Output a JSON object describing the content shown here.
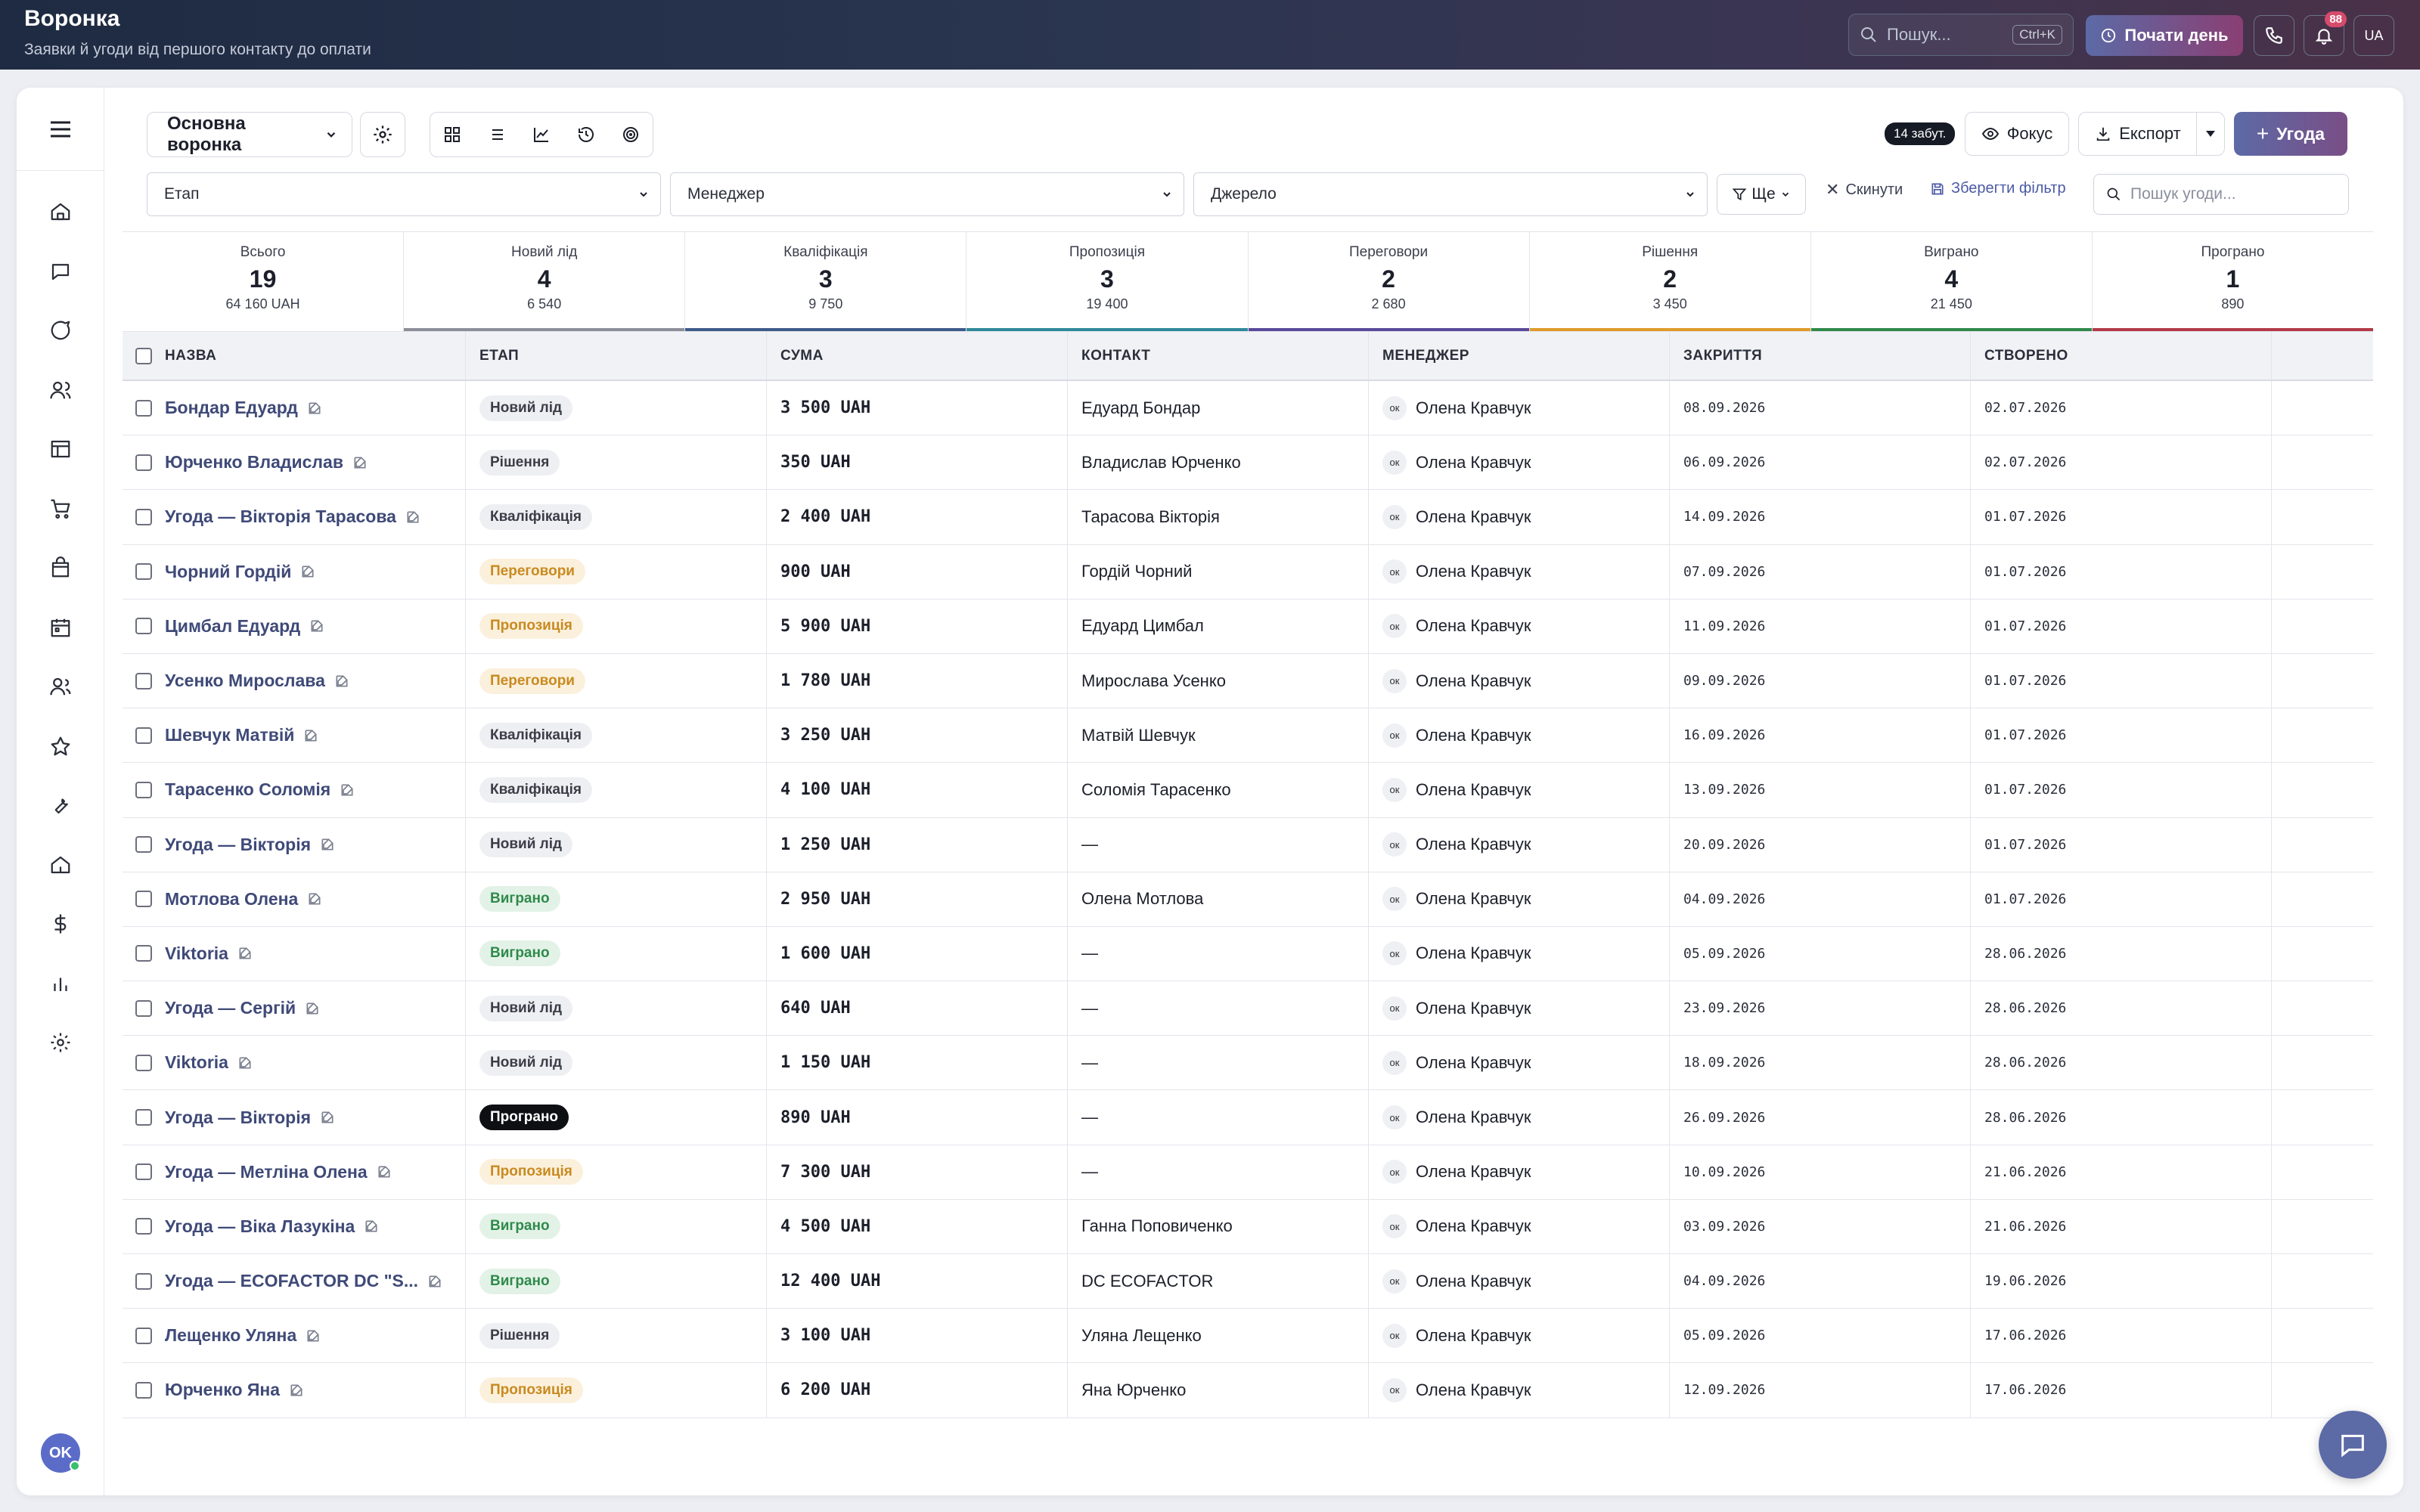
{
  "header": {
    "title": "Воронка",
    "subtitle": "Заявки й угоди від першого контакту до оплати",
    "search_placeholder": "Пошук...",
    "search_shortcut": "Ctrl+K",
    "start_day_label": "Почати день",
    "notifications_count": "88",
    "lang": "UA"
  },
  "sidebar": {
    "icons": [
      "home-icon",
      "chat-icon",
      "message-icon",
      "users-icon",
      "layout-icon",
      "cart-icon",
      "bag-icon",
      "calendar-icon",
      "team-icon",
      "star-icon",
      "wrench-icon",
      "building-icon",
      "dollar-icon",
      "chart-icon",
      "settings-icon"
    ],
    "user_initials": "OK"
  },
  "toolbar": {
    "funnel_label": "Основна воронка",
    "forgotten_badge": "14 забут.",
    "focus_label": "Фокус",
    "export_label": "Експорт",
    "add_deal_label": "Угода"
  },
  "filters": {
    "stage": "Етап",
    "manager": "Менеджер",
    "source": "Джерело",
    "more": "Ще",
    "reset": "Скинути",
    "save": "Зберегти фільтр",
    "search_placeholder": "Пошук угоди..."
  },
  "stats": [
    {
      "label": "Всього",
      "count": "19",
      "sum": "64 160 UAH",
      "color": "#ffffff"
    },
    {
      "label": "Новий лід",
      "count": "4",
      "sum": "6 540",
      "color": "#8c8f99"
    },
    {
      "label": "Кваліфікація",
      "count": "3",
      "sum": "9 750",
      "color": "#3d5a8a"
    },
    {
      "label": "Пропозиція",
      "count": "3",
      "sum": "19 400",
      "color": "#2e8a9a"
    },
    {
      "label": "Переговори",
      "count": "2",
      "sum": "2 680",
      "color": "#5a4a9a"
    },
    {
      "label": "Рішення",
      "count": "2",
      "sum": "3 450",
      "color": "#e09a2a"
    },
    {
      "label": "Виграно",
      "count": "4",
      "sum": "21 450",
      "color": "#2f8a4b"
    },
    {
      "label": "Програно",
      "count": "1",
      "sum": "890",
      "color": "#b23a4a"
    }
  ],
  "table": {
    "columns": [
      "НАЗВА",
      "ЕТАП",
      "СУМА",
      "КОНТАКТ",
      "МЕНЕДЖЕР",
      "ЗАКРИТТЯ",
      "СТВОРЕНО"
    ],
    "rows": [
      {
        "name": "Бондар Едуард",
        "stage": "Новий лід",
        "stage_class": "p-new",
        "sum": "3 500 UAH",
        "contact": "Едуард Бондар",
        "mgr_initials": "ок",
        "manager": "Олена Кравчук",
        "close": "08.09.2026",
        "created": "02.07.2026"
      },
      {
        "name": "Юрченко Владислав",
        "stage": "Рішення",
        "stage_class": "p-dec",
        "sum": "350 UAH",
        "contact": "Владислав Юрченко",
        "mgr_initials": "ок",
        "manager": "Олена Кравчук",
        "close": "06.09.2026",
        "created": "02.07.2026"
      },
      {
        "name": "Угода — Вікторія Тарасова",
        "stage": "Кваліфікація",
        "stage_class": "p-qual",
        "sum": "2 400 UAH",
        "contact": "Тарасова Вікторія",
        "mgr_initials": "ок",
        "manager": "Олена Кравчук",
        "close": "14.09.2026",
        "created": "01.07.2026"
      },
      {
        "name": "Чорний Гордій",
        "stage": "Переговори",
        "stage_class": "p-neg",
        "sum": "900 UAH",
        "contact": "Гордій Чорний",
        "mgr_initials": "ок",
        "manager": "Олена Кравчук",
        "close": "07.09.2026",
        "created": "01.07.2026"
      },
      {
        "name": "Цимбал Едуард",
        "stage": "Пропозиція",
        "stage_class": "p-prop",
        "sum": "5 900 UAH",
        "contact": "Едуард Цимбал",
        "mgr_initials": "ок",
        "manager": "Олена Кравчук",
        "close": "11.09.2026",
        "created": "01.07.2026"
      },
      {
        "name": "Усенко Мирослава",
        "stage": "Переговори",
        "stage_class": "p-neg",
        "sum": "1 780 UAH",
        "contact": "Мирослава Усенко",
        "mgr_initials": "ок",
        "manager": "Олена Кравчук",
        "close": "09.09.2026",
        "created": "01.07.2026"
      },
      {
        "name": "Шевчук Матвій",
        "stage": "Кваліфікація",
        "stage_class": "p-qual",
        "sum": "3 250 UAH",
        "contact": "Матвій Шевчук",
        "mgr_initials": "ок",
        "manager": "Олена Кравчук",
        "close": "16.09.2026",
        "created": "01.07.2026"
      },
      {
        "name": "Тарасенко Соломія",
        "stage": "Кваліфікація",
        "stage_class": "p-qual",
        "sum": "4 100 UAH",
        "contact": "Соломія Тарасенко",
        "mgr_initials": "ок",
        "manager": "Олена Кравчук",
        "close": "13.09.2026",
        "created": "01.07.2026"
      },
      {
        "name": "Угода — Вікторія",
        "stage": "Новий лід",
        "stage_class": "p-new",
        "sum": "1 250 UAH",
        "contact": "—",
        "mgr_initials": "ок",
        "manager": "Олена Кравчук",
        "close": "20.09.2026",
        "created": "01.07.2026"
      },
      {
        "name": "Мотлова Олена",
        "stage": "Виграно",
        "stage_class": "p-won",
        "sum": "2 950 UAH",
        "contact": "Олена Мотлова",
        "mgr_initials": "ок",
        "manager": "Олена Кравчук",
        "close": "04.09.2026",
        "created": "01.07.2026"
      },
      {
        "name": "Viktoria",
        "stage": "Виграно",
        "stage_class": "p-won",
        "sum": "1 600 UAH",
        "contact": "—",
        "mgr_initials": "ок",
        "manager": "Олена Кравчук",
        "close": "05.09.2026",
        "created": "28.06.2026"
      },
      {
        "name": "Угода — Сергій",
        "stage": "Новий лід",
        "stage_class": "p-new",
        "sum": "640 UAH",
        "contact": "—",
        "mgr_initials": "ок",
        "manager": "Олена Кравчук",
        "close": "23.09.2026",
        "created": "28.06.2026"
      },
      {
        "name": "Viktoria",
        "stage": "Новий лід",
        "stage_class": "p-new",
        "sum": "1 150 UAH",
        "contact": "—",
        "mgr_initials": "ок",
        "manager": "Олена Кравчук",
        "close": "18.09.2026",
        "created": "28.06.2026"
      },
      {
        "name": "Угода — Вікторія",
        "stage": "Програно",
        "stage_class": "p-lost",
        "sum": "890 UAH",
        "contact": "—",
        "mgr_initials": "ок",
        "manager": "Олена Кравчук",
        "close": "26.09.2026",
        "created": "28.06.2026"
      },
      {
        "name": "Угода — Метліна Олена",
        "stage": "Пропозиція",
        "stage_class": "p-prop",
        "sum": "7 300 UAH",
        "contact": "—",
        "mgr_initials": "ок",
        "manager": "Олена Кравчук",
        "close": "10.09.2026",
        "created": "21.06.2026"
      },
      {
        "name": "Угода — Віка Лазукіна",
        "stage": "Виграно",
        "stage_class": "p-won",
        "sum": "4 500 UAH",
        "contact": "Ганна Поповиченко",
        "mgr_initials": "ок",
        "manager": "Олена Кравчук",
        "close": "03.09.2026",
        "created": "21.06.2026"
      },
      {
        "name": "Угода — ECOFACTOR DC \"S...",
        "stage": "Виграно",
        "stage_class": "p-won",
        "sum": "12 400 UAH",
        "contact": "DC ECOFACTOR",
        "mgr_initials": "ок",
        "manager": "Олена Кравчук",
        "close": "04.09.2026",
        "created": "19.06.2026"
      },
      {
        "name": "Лещенко Уляна",
        "stage": "Рішення",
        "stage_class": "p-dec",
        "sum": "3 100 UAH",
        "contact": "Уляна Лещенко",
        "mgr_initials": "ок",
        "manager": "Олена Кравчук",
        "close": "05.09.2026",
        "created": "17.06.2026"
      },
      {
        "name": "Юрченко Яна",
        "stage": "Пропозиція",
        "stage_class": "p-prop",
        "sum": "6 200 UAH",
        "contact": "Яна Юрченко",
        "mgr_initials": "ок",
        "manager": "Олена Кравчук",
        "close": "12.09.2026",
        "created": "17.06.2026"
      }
    ]
  }
}
